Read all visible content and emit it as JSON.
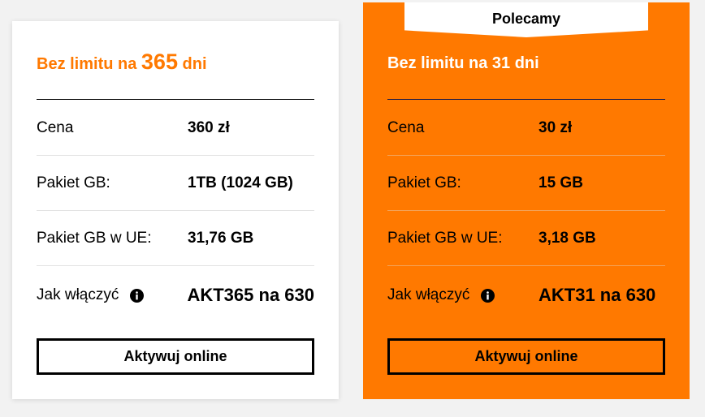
{
  "plans": [
    {
      "title_prefix": "Bez limitu na ",
      "title_number": "365",
      "title_suffix": " dni",
      "rows": [
        {
          "label": "Cena",
          "value": "360 zł"
        },
        {
          "label": "Pakiet GB:",
          "value": "1TB (1024 GB)"
        },
        {
          "label": "Pakiet GB w UE:",
          "value": "31,76 GB"
        },
        {
          "label": "Jak włączyć",
          "value": "AKT365 na 630"
        }
      ],
      "button_label": "Aktywuj online"
    },
    {
      "badge": "Polecamy",
      "title": "Bez limitu na 31 dni",
      "rows": [
        {
          "label": "Cena",
          "value": "30 zł"
        },
        {
          "label": "Pakiet GB:",
          "value": "15 GB"
        },
        {
          "label": "Pakiet GB w UE:",
          "value": "3,18 GB"
        },
        {
          "label": "Jak włączyć",
          "value": "AKT31 na 630"
        }
      ],
      "button_label": "Aktywuj online"
    }
  ],
  "colors": {
    "accent": "#ff7900",
    "card_background": "#ffffff",
    "page_background": "#f2f2f2"
  },
  "icons": {
    "info": "info-icon"
  }
}
